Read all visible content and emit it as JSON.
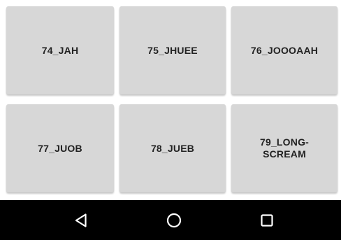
{
  "buttons": [
    {
      "label": "74_JAH"
    },
    {
      "label": "75_JHUEE"
    },
    {
      "label": "76_JOOOAAH"
    },
    {
      "label": "77_JUOB"
    },
    {
      "label": "78_JUEB"
    },
    {
      "label": "79_LONG-\nSCREAM"
    }
  ],
  "navbar": {
    "back_icon": "back-triangle-icon",
    "home_icon": "home-circle-icon",
    "recents_icon": "recents-square-icon"
  },
  "colors": {
    "button_bg": "#d7d7d7",
    "label_text": "#222222",
    "navbar_bg": "#000000",
    "nav_icon": "#ffffff"
  }
}
